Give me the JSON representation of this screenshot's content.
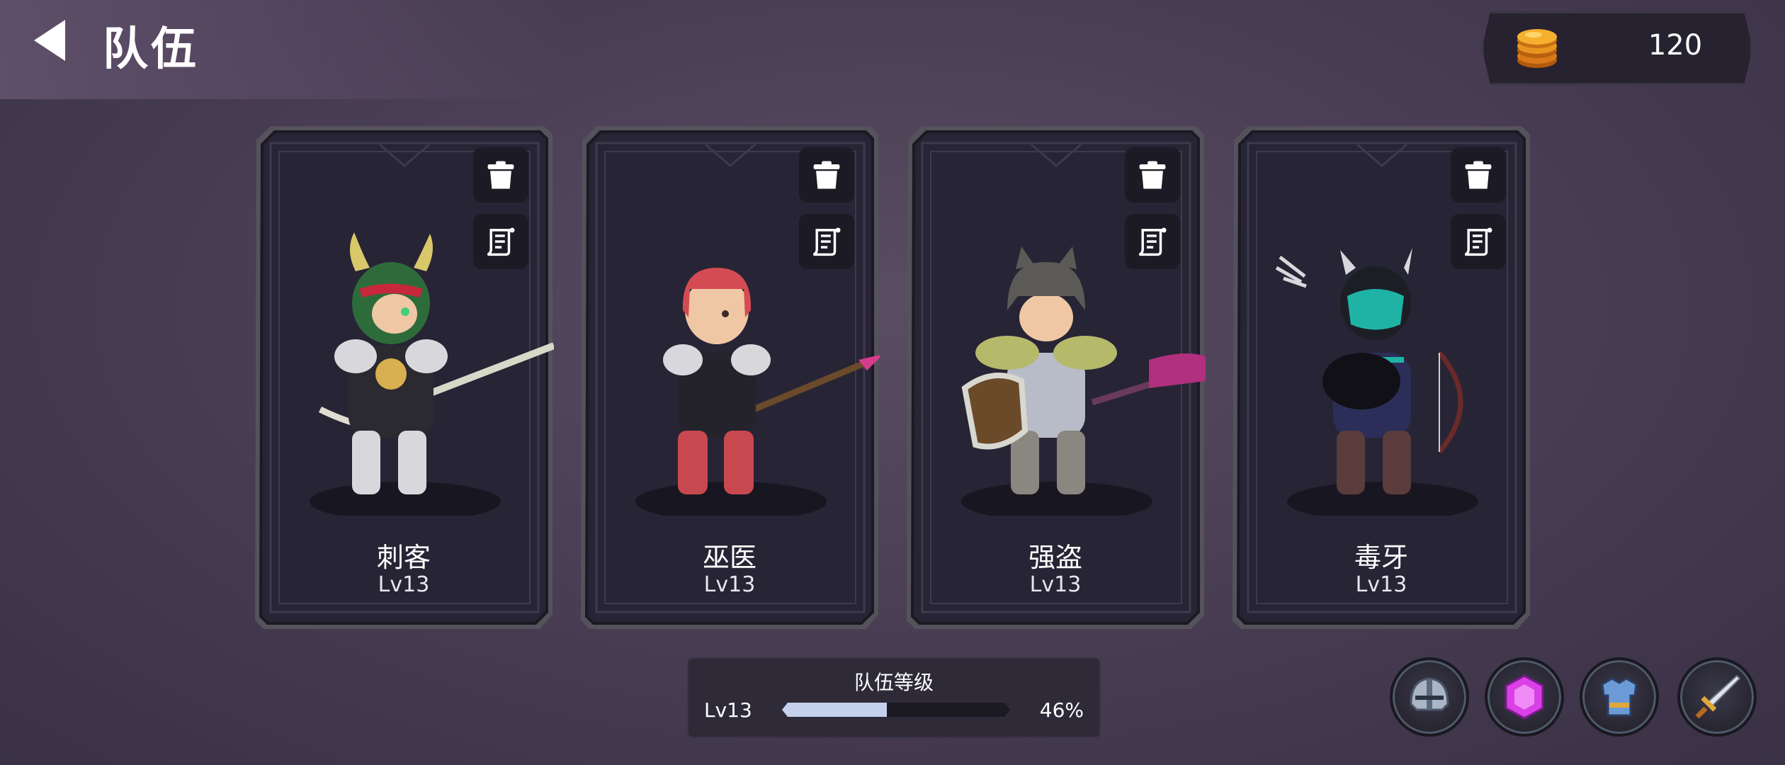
{
  "header": {
    "title": "队伍"
  },
  "currency": {
    "amount": "120",
    "icon": "coin-stack-icon"
  },
  "cards": [
    {
      "name": "刺客",
      "level": "Lv13",
      "accent": "#2e6b3a"
    },
    {
      "name": "巫医",
      "level": "Lv13",
      "accent": "#c84850"
    },
    {
      "name": "强盗",
      "level": "Lv13",
      "accent": "#5c5a56"
    },
    {
      "name": "毒牙",
      "level": "Lv13",
      "accent": "#1fb3a6"
    }
  ],
  "team": {
    "title": "队伍等级",
    "level": "Lv13",
    "percent_label": "46%",
    "progress": 0.46
  },
  "actions": [
    {
      "icon": "helmet-icon"
    },
    {
      "icon": "gem-icon"
    },
    {
      "icon": "armor-icon"
    },
    {
      "icon": "sword-icon"
    }
  ],
  "colors": {
    "progress_fill": "#c5d0ec",
    "panel": "#26222f",
    "card_bg": "#272435",
    "gem": "#d940e6"
  }
}
